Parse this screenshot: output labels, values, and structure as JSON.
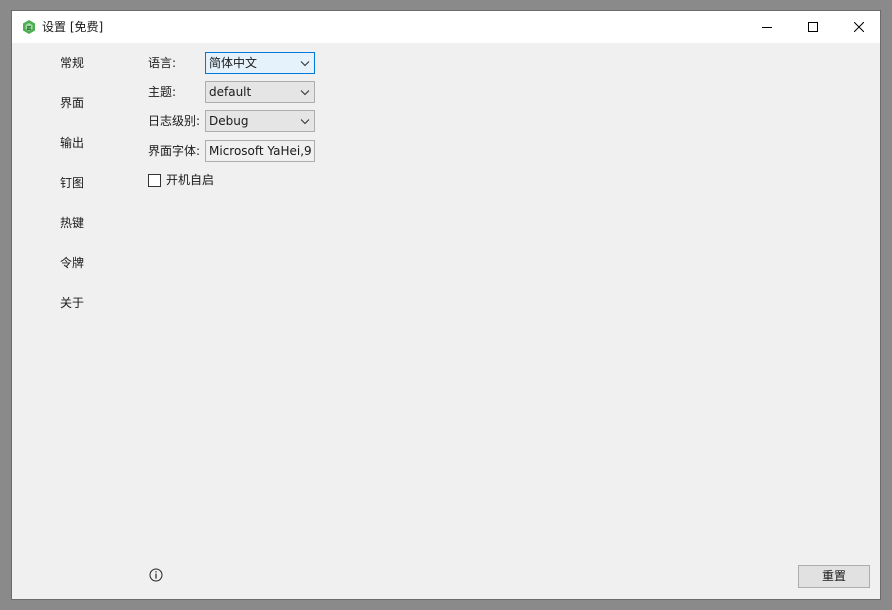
{
  "window": {
    "title": "设置 [免费]",
    "icon": "app-logo-icon",
    "controls": {
      "minimize": "minimize-icon",
      "maximize": "maximize-icon",
      "close": "close-icon"
    }
  },
  "sidebar": {
    "items": [
      {
        "label": "常规"
      },
      {
        "label": "界面"
      },
      {
        "label": "输出"
      },
      {
        "label": "钉图"
      },
      {
        "label": "热键"
      },
      {
        "label": "令牌"
      },
      {
        "label": "关于"
      }
    ]
  },
  "settings": {
    "language": {
      "label": "语言:",
      "value": "简体中文"
    },
    "theme": {
      "label": "主题:",
      "value": "default"
    },
    "log_level": {
      "label": "日志级别:",
      "value": "Debug"
    },
    "ui_font": {
      "label": "界面字体:",
      "value": "Microsoft YaHei,9"
    },
    "autostart": {
      "label": "开机自启",
      "checked": false
    }
  },
  "footer": {
    "info_icon": "info-icon",
    "reset_label": "重置"
  },
  "colors": {
    "accent": "#0078d7",
    "window_bg": "#f0f0f0",
    "titlebar_bg": "#ffffff",
    "logo_green": "#4caf50"
  }
}
